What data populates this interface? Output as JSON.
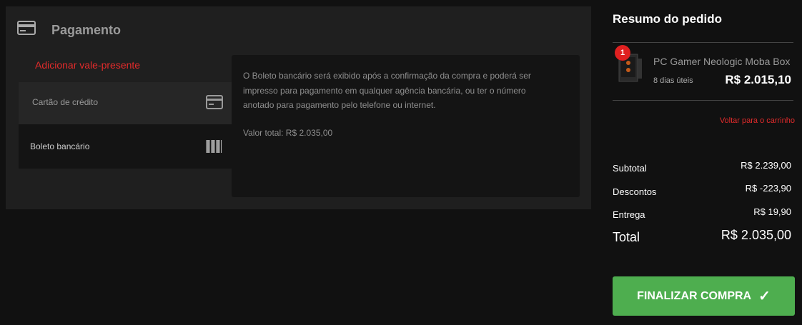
{
  "payment": {
    "title": "Pagamento",
    "gift_card_link": "Adicionar vale-presente",
    "methods": [
      {
        "label": "Cartão de crédito",
        "icon": "credit-card-icon"
      },
      {
        "label": "Boleto bancário",
        "icon": "barcode-icon",
        "selected": true
      }
    ],
    "boleto_info": "O Boleto bancário será exibido após a confirmação da compra e poderá ser impresso para pagamento em qualquer agência bancária, ou ter o número anotado para pagamento pelo telefone ou internet.",
    "boleto_total": "Valor total: R$ 2.035,00"
  },
  "summary": {
    "title": "Resumo do pedido",
    "item": {
      "quantity": "1",
      "name": "PC Gamer Neologic Moba Box",
      "delivery": "8 dias úteis",
      "price": "R$ 2.015,10"
    },
    "back_link": "Voltar para o carrinho",
    "subtotal_label": "Subtotal",
    "subtotal_value": "R$ 2.239,00",
    "discount_label": "Descontos",
    "discount_value": "R$ -223,90",
    "shipping_label": "Entrega",
    "shipping_value": "R$ 19,90",
    "total_label": "Total",
    "total_value": "R$ 2.035,00"
  },
  "finish_button": {
    "label": "FINALIZAR COMPRA",
    "icon": "checkmark-icon"
  },
  "colors": {
    "accent_red": "#e22b2b",
    "button_green": "#4eae4f",
    "background": "#111111"
  }
}
